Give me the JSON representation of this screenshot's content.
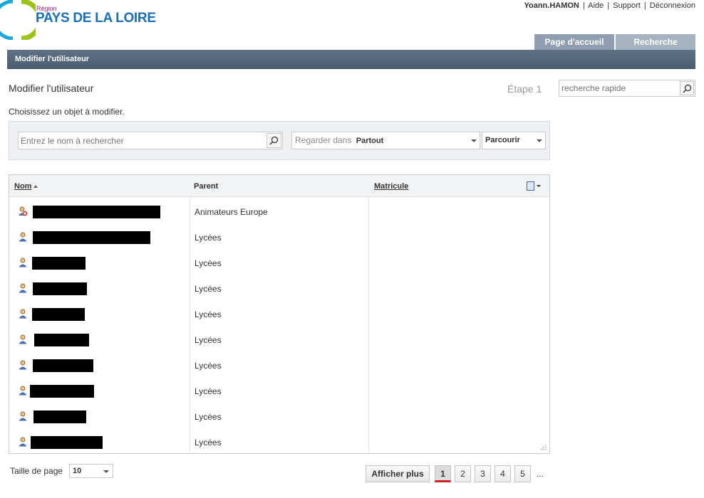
{
  "brand": {
    "region_label": "Région",
    "name": "PAYS DE LA LOIRE",
    "accent_blue": "#1c6fb5",
    "accent_green": "#9cc31a",
    "accent_cyan": "#1aa7d9"
  },
  "toplinks": {
    "user": "Yoann.HAMON",
    "help": "Aide",
    "support": "Support",
    "logout": "Déconnexion",
    "separator": "|"
  },
  "tabs": [
    {
      "label": "Page d'accueil",
      "active": true
    },
    {
      "label": "Recherche",
      "active": false
    }
  ],
  "titlebar": "Modifier l'utilisateur",
  "heading": "Modifier l'utilisateur",
  "step": "Étape 1",
  "quick_search": {
    "placeholder": "recherche rapide",
    "icon": "search-icon"
  },
  "instruction": "Choisissez un objet à modifier.",
  "search": {
    "name_placeholder": "Entrez le nom à rechercher",
    "look_in_label": "Regarder dans",
    "look_in_value": "Partout",
    "browse": "Parcourir"
  },
  "table": {
    "headers": {
      "name": "Nom",
      "parent": "Parent",
      "matricule": "Matricule"
    },
    "rows": [
      {
        "parent": "Animateurs Europe",
        "icon": "user-disabled-icon",
        "name_redacted": true
      },
      {
        "parent": "Lycées",
        "icon": "user-icon",
        "name_redacted": true
      },
      {
        "parent": "Lycées",
        "icon": "user-icon",
        "name_redacted": true
      },
      {
        "parent": "Lycées",
        "icon": "user-icon",
        "name_redacted": true
      },
      {
        "parent": "Lycées",
        "icon": "user-icon",
        "name_redacted": true
      },
      {
        "parent": "Lycées",
        "icon": "user-icon",
        "name_redacted": true
      },
      {
        "parent": "Lycées",
        "icon": "user-icon",
        "name_redacted": true
      },
      {
        "parent": "Lycées",
        "icon": "user-icon",
        "name_redacted": true
      },
      {
        "parent": "Lycées",
        "icon": "user-icon",
        "name_redacted": true
      },
      {
        "parent": "Lycées",
        "icon": "user-icon",
        "name_redacted": true
      }
    ]
  },
  "footer": {
    "page_size_label": "Taille de page",
    "page_size_value": "10",
    "more": "Afficher plus",
    "pages": [
      "1",
      "2",
      "3",
      "4",
      "5"
    ],
    "current_page": "1",
    "ellipsis": "..."
  }
}
